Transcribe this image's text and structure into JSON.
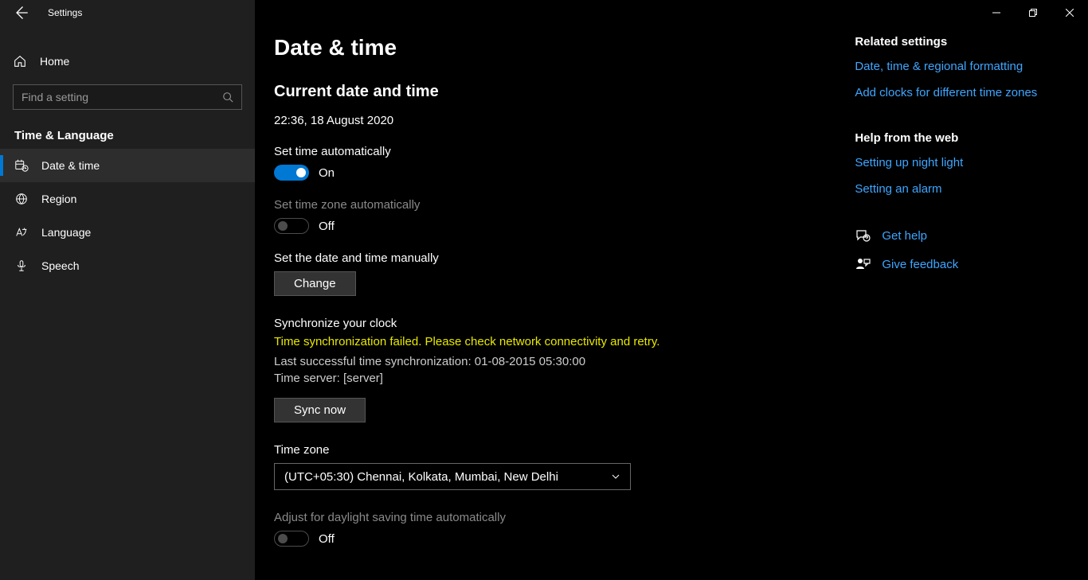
{
  "app_title": "Settings",
  "sidebar": {
    "home": "Home",
    "search_placeholder": "Find a setting",
    "group": "Time & Language",
    "items": [
      {
        "label": "Date & time"
      },
      {
        "label": "Region"
      },
      {
        "label": "Language"
      },
      {
        "label": "Speech"
      }
    ]
  },
  "page": {
    "title": "Date & time",
    "current_heading": "Current date and time",
    "current_value": "22:36, 18 August 2020",
    "auto_time_label": "Set time automatically",
    "auto_time_state": "On",
    "auto_tz_label": "Set time zone automatically",
    "auto_tz_state": "Off",
    "manual_label": "Set the date and time manually",
    "change_btn": "Change",
    "sync_heading": "Synchronize your clock",
    "sync_error": "Time synchronization failed. Please check network connectivity and retry.",
    "sync_last": "Last successful time synchronization: 01-08-2015 05:30:00",
    "sync_server": "Time server: [server]",
    "sync_btn": "Sync now",
    "tz_label": "Time zone",
    "tz_value": "(UTC+05:30) Chennai, Kolkata, Mumbai, New Delhi",
    "dst_label": "Adjust for daylight saving time automatically",
    "dst_state": "Off"
  },
  "rail": {
    "related_title": "Related settings",
    "related": [
      "Date, time & regional formatting",
      "Add clocks for different time zones"
    ],
    "help_title": "Help from the web",
    "help": [
      "Setting up night light",
      "Setting an alarm"
    ],
    "get_help": "Get help",
    "give_feedback": "Give feedback"
  }
}
